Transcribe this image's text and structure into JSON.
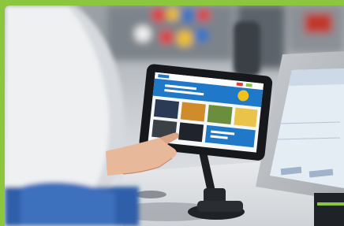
{
  "scene": {
    "border_color": "#8cc63f",
    "tablet_accent": "#1f78c8",
    "shelf_colors": [
      "#e23b3b",
      "#f2c21b",
      "#2f74c9",
      "#f5f5f5"
    ]
  }
}
